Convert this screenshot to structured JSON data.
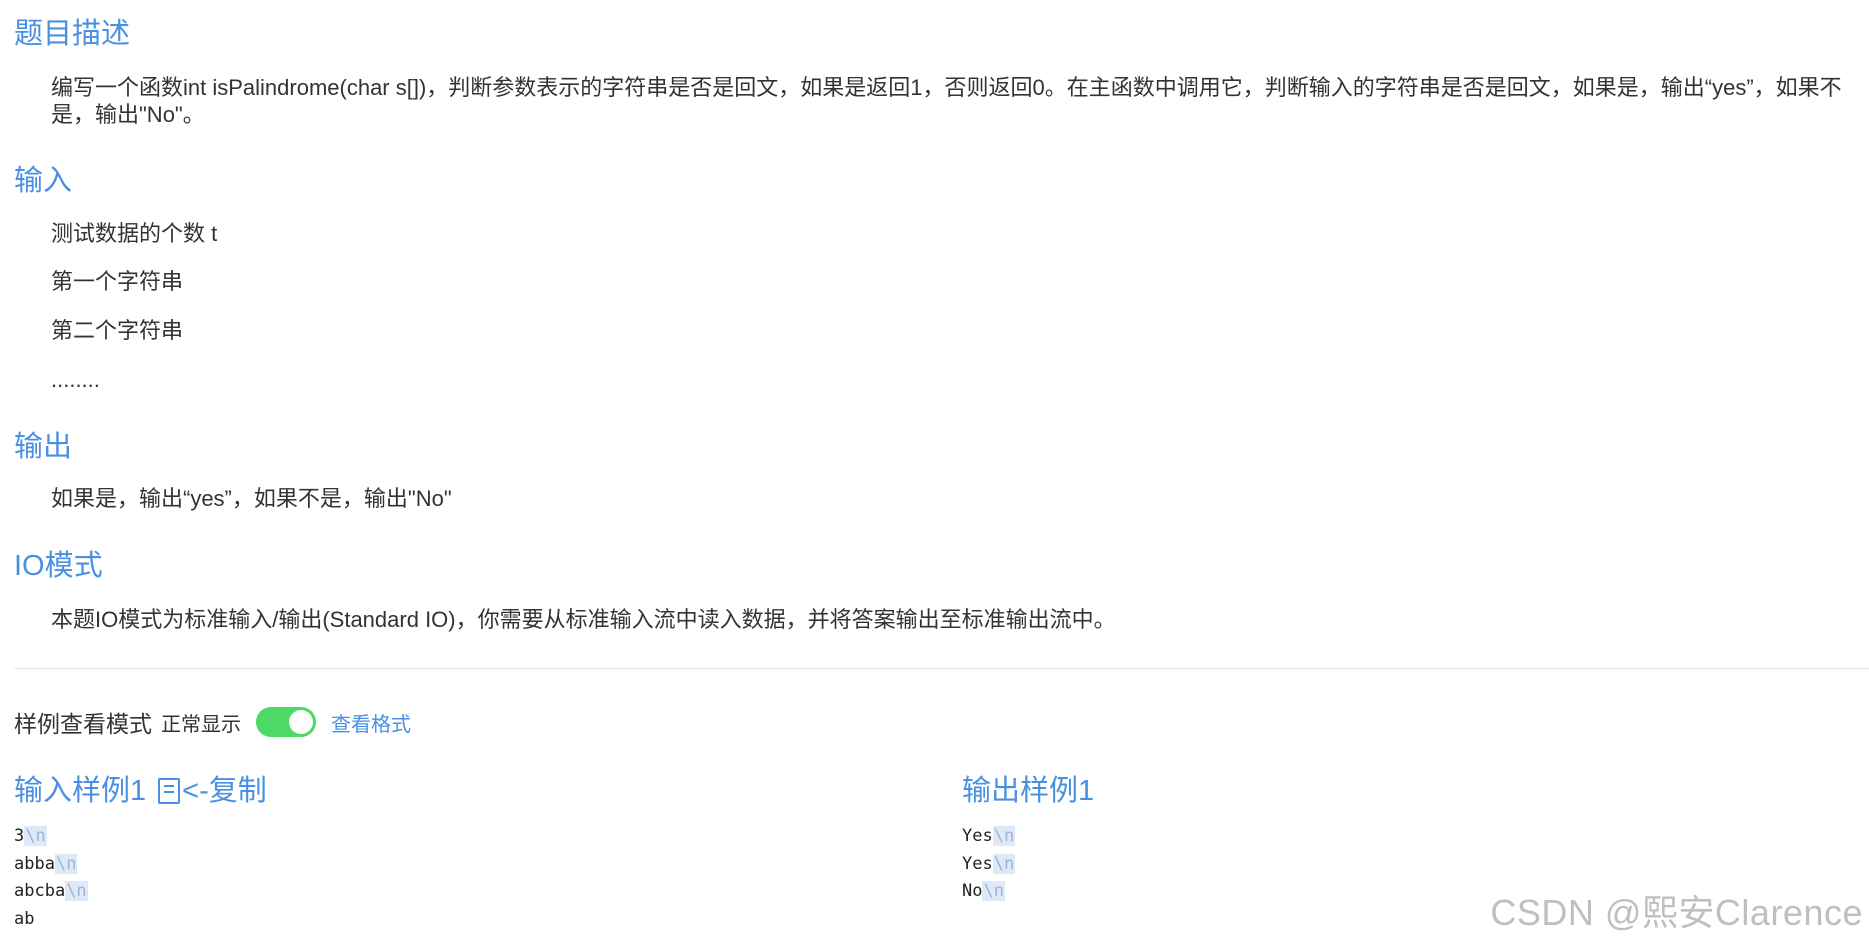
{
  "sections": {
    "description": {
      "title": "题目描述",
      "text": "编写一个函数int isPalindrome(char s[])，判断参数表示的字符串是否是回文，如果是返回1，否则返回0。在主函数中调用它，判断输入的字符串是否是回文，如果是，输出“yes”，如果不是，输出\"No\"。"
    },
    "input": {
      "title": "输入",
      "lines": [
        "测试数据的个数 t",
        "第一个字符串",
        "第二个字符串",
        "........"
      ]
    },
    "output": {
      "title": "输出",
      "text": "如果是，输出“yes”，如果不是，输出\"No\""
    },
    "io_mode": {
      "title": "IO模式",
      "text": "本题IO模式为标准输入/输出(Standard IO)，你需要从标准输入流中读入数据，并将答案输出至标准输出流中。"
    }
  },
  "sample_mode": {
    "label": "样例查看模式",
    "state": "正常显示",
    "toggle_on": true,
    "view_format": "查看格式"
  },
  "input_sample": {
    "title": "输入样例1",
    "copy_label": "<-复制",
    "lines": [
      {
        "text": "3",
        "newline": "\\n"
      },
      {
        "text": "abba",
        "newline": "\\n"
      },
      {
        "text": "abcba",
        "newline": "\\n"
      },
      {
        "text": "ab",
        "newline": ""
      }
    ]
  },
  "output_sample": {
    "title": "输出样例1",
    "lines": [
      {
        "text": "Yes",
        "newline": "\\n"
      },
      {
        "text": "Yes",
        "newline": "\\n"
      },
      {
        "text": "No",
        "newline": "\\n"
      }
    ]
  },
  "watermark": "CSDN @熙安Clarence",
  "colors": {
    "accent": "#4a90e2",
    "toggle": "#4cd964",
    "newline_bg": "#dde8f8"
  }
}
